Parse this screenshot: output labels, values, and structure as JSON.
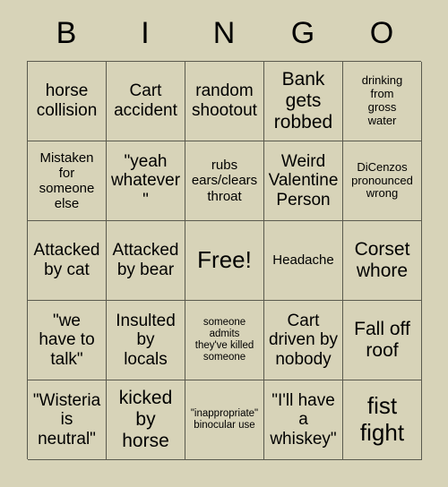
{
  "card": {
    "header_letters": [
      "B",
      "I",
      "N",
      "G",
      "O"
    ],
    "rows": [
      [
        {
          "text": "horse\ncollision",
          "size": "md"
        },
        {
          "text": "Cart\naccident",
          "size": "md"
        },
        {
          "text": "random\nshootout",
          "size": "md"
        },
        {
          "text": "Bank\ngets\nrobbed",
          "size": "lg"
        },
        {
          "text": "drinking\nfrom\ngross\nwater",
          "size": "xs"
        }
      ],
      [
        {
          "text": "Mistaken\nfor\nsomeone\nelse",
          "size": "sm"
        },
        {
          "text": "\"yeah\nwhatever\"",
          "size": "md"
        },
        {
          "text": "rubs\nears/clears\nthroat",
          "size": "sm"
        },
        {
          "text": "Weird\nValentine\nPerson",
          "size": "md"
        },
        {
          "text": "DiCenzos\npronounced\nwrong",
          "size": "xs"
        }
      ],
      [
        {
          "text": "Attacked\nby cat",
          "size": "md"
        },
        {
          "text": "Attacked\nby bear",
          "size": "md"
        },
        {
          "text": "Free!",
          "size": "xl"
        },
        {
          "text": "Headache",
          "size": "sm"
        },
        {
          "text": "Corset\nwhore",
          "size": "lg"
        }
      ],
      [
        {
          "text": "\"we\nhave to\ntalk\"",
          "size": "md"
        },
        {
          "text": "Insulted\nby\nlocals",
          "size": "md"
        },
        {
          "text": "someone\nadmits\nthey've killed\nsomeone",
          "size": "xxs"
        },
        {
          "text": "Cart\ndriven by\nnobody",
          "size": "md"
        },
        {
          "text": "Fall off\nroof",
          "size": "lg"
        }
      ],
      [
        {
          "text": "\"Wisteria\nis\nneutral\"",
          "size": "md"
        },
        {
          "text": "kicked\nby\nhorse",
          "size": "lg"
        },
        {
          "text": "\"inappropriate\"\nbinocular use",
          "size": "xxs"
        },
        {
          "text": "\"I'll have\na\nwhiskey\"",
          "size": "md"
        },
        {
          "text": "fist\nfight",
          "size": "xl"
        }
      ]
    ]
  },
  "colors": {
    "background": "#d7d3b8",
    "grid_line": "#5a5a4e",
    "text": "#000000"
  }
}
